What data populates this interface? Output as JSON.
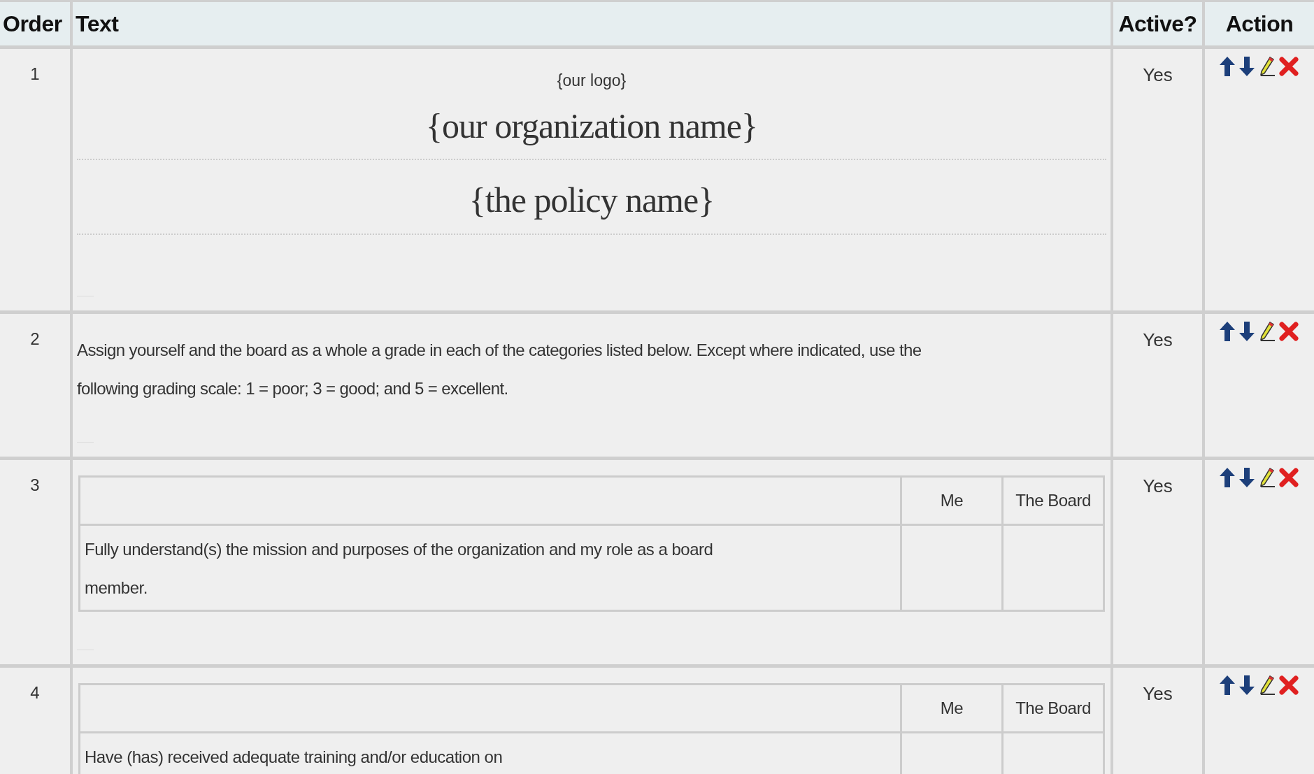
{
  "table": {
    "columns": [
      "Order",
      "Text",
      "Active?",
      "Action"
    ],
    "rows": [
      {
        "order": "1",
        "kind": "title",
        "logo": "{our logo}",
        "org_name": "{our organization name}",
        "policy_name": "{the policy name}",
        "active": "Yes"
      },
      {
        "order": "2",
        "kind": "paragraph",
        "text": "Assign yourself and the board as a whole a grade in each of the categories listed below. Except where indicated, use the following grading scale: 1 = poor; 3 = good; and 5 = excellent.",
        "active": "Yes"
      },
      {
        "order": "3",
        "kind": "grid",
        "columns": [
          "Me",
          "The Board"
        ],
        "items": [
          "Fully understand(s) the mission and purposes of the organization and my role as a board member."
        ],
        "active": "Yes"
      },
      {
        "order": "4",
        "kind": "grid",
        "columns": [
          "Me",
          "The Board"
        ],
        "items": [
          "Have (has) received adequate training and/or education on"
        ],
        "active": "Yes"
      }
    ]
  }
}
